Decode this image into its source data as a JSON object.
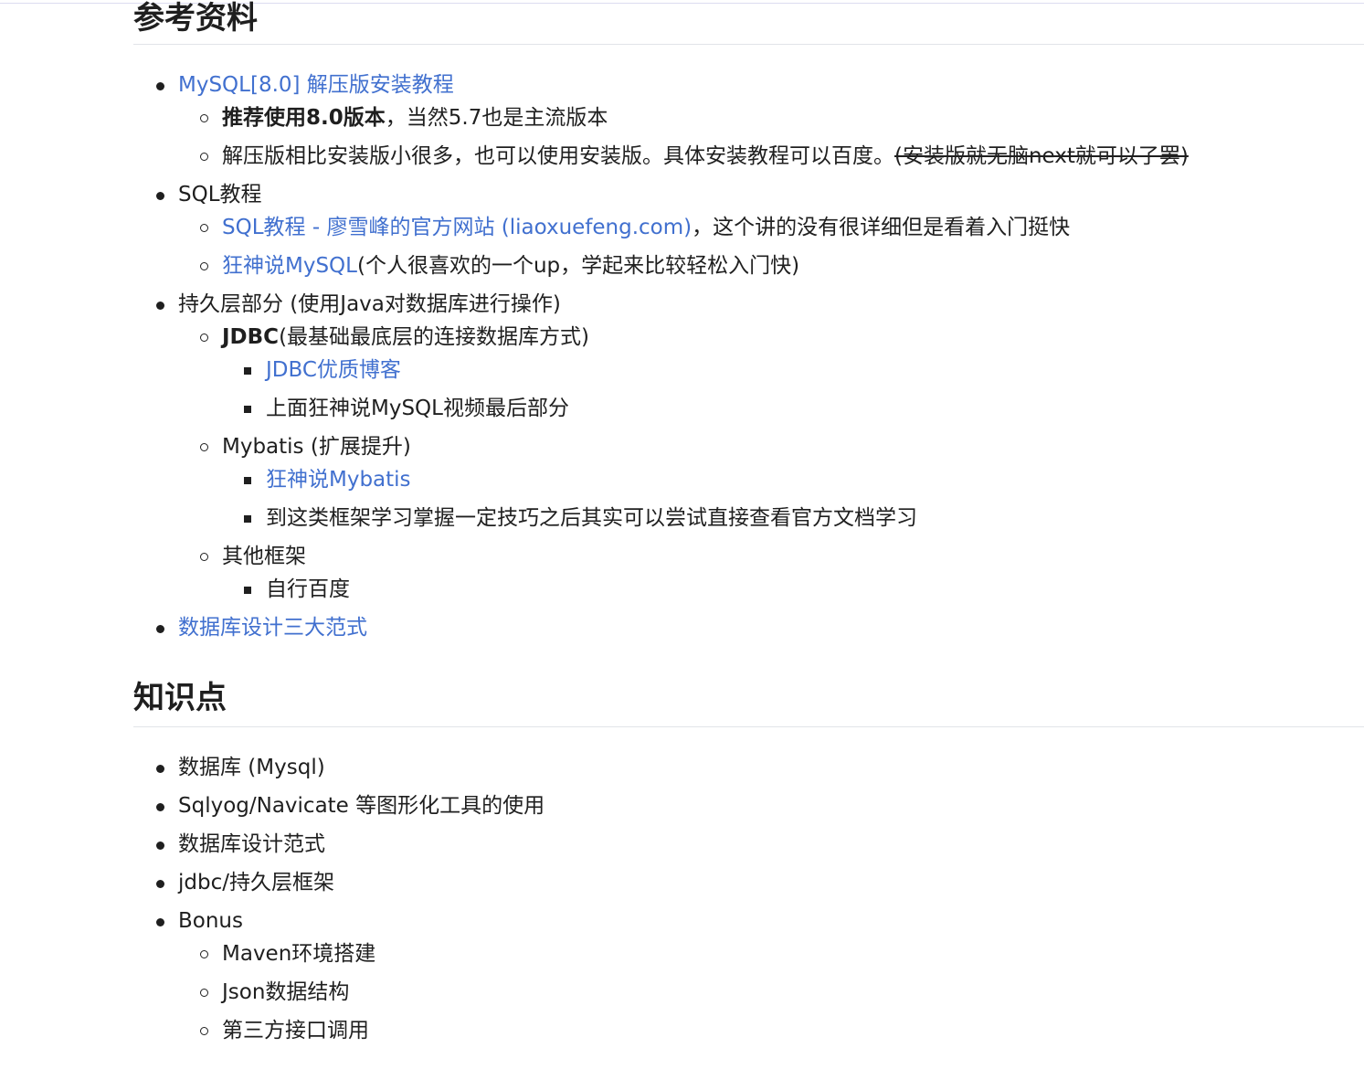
{
  "sections": {
    "references": {
      "title": "参考资料",
      "mysql": {
        "link": "MySQL[8.0] 解压版安装教程",
        "sub1_bold": "推荐使用8.0版本",
        "sub1_rest": "，当然5.7也是主流版本",
        "sub2_text": "解压版相比安装版小很多，也可以使用安装版。具体安装教程可以百度。",
        "sub2_strike": "(安装版就无脑next就可以了罢)"
      },
      "sql": {
        "label": "SQL教程",
        "sub1_link": "SQL教程 - 廖雪峰的官方网站 (liaoxuefeng.com)",
        "sub1_rest": "，这个讲的没有很详细但是看着入门挺快",
        "sub2_link": "狂神说MySQL",
        "sub2_rest": "(个人很喜欢的一个up，学起来比较轻松入门快)"
      },
      "persistence": {
        "label": "持久层部分 (使用Java对数据库进行操作)",
        "jdbc_bold": "JDBC",
        "jdbc_rest": "(最基础最底层的连接数据库方式)",
        "jdbc_item1_link": "JDBC优质博客",
        "jdbc_item2": "上面狂神说MySQL视频最后部分",
        "mybatis": "Mybatis (扩展提升)",
        "mybatis_item1_link": "狂神说Mybatis",
        "mybatis_item2": "到这类框架学习掌握一定技巧之后其实可以尝试直接查看官方文档学习",
        "others": "其他框架",
        "others_item1": "自行百度"
      },
      "db_design_link": "数据库设计三大范式"
    },
    "knowledge": {
      "title": "知识点",
      "items": [
        "数据库 (Mysql)",
        "Sqlyog/Navicate 等图形化工具的使用",
        "数据库设计范式",
        "jdbc/持久层框架",
        "Bonus"
      ],
      "bonus_items": [
        "Maven环境搭建",
        "Json数据结构",
        "第三方接口调用"
      ]
    }
  },
  "colors": {
    "link": "#4170cf",
    "text": "#1f1f1f",
    "divider": "#e1e4e8"
  }
}
